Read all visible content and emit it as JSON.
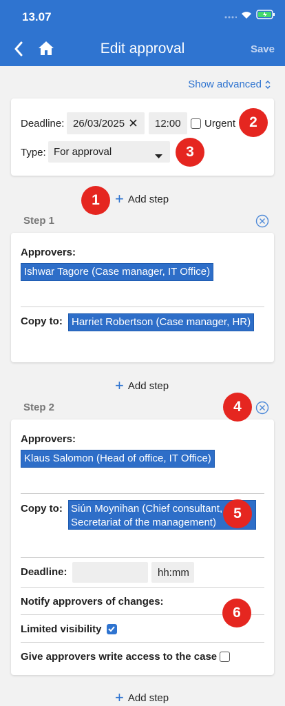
{
  "status": {
    "time": "13.07"
  },
  "header": {
    "title": "Edit approval",
    "save_label": "Save"
  },
  "show_advanced": "Show advanced",
  "settings": {
    "deadline_label": "Deadline:",
    "deadline_date": "26/03/2025",
    "deadline_time": "12:00",
    "urgent_label": "Urgent",
    "type_label": "Type:",
    "type_value": "For approval"
  },
  "add_step_label": "Add step",
  "steps": [
    {
      "title": "Step 1",
      "approvers_label": "Approvers:",
      "approvers": [
        "Ishwar Tagore (Case manager, IT Office)"
      ],
      "copy_label": "Copy to:",
      "copy_to": [
        "Harriet Robertson (Case manager, HR)"
      ]
    },
    {
      "title": "Step 2",
      "approvers_label": "Approvers:",
      "approvers": [
        "Klaus Salomon (Head of office, IT Office)"
      ],
      "copy_label": "Copy to:",
      "copy_to_line1": "Siún Moynihan (Chief consultant,",
      "copy_to_line2": "Secretariat of the management)",
      "deadline_label": "Deadline:",
      "time_placeholder": "hh:mm",
      "notify_label": "Notify approvers of changes:",
      "limited_label": "Limited visibility",
      "limited_checked": true,
      "write_access_label": "Give approvers write access to the case",
      "write_access_checked": false
    }
  ],
  "badges": [
    "1",
    "2",
    "3",
    "4",
    "5",
    "6"
  ],
  "colors": {
    "header": "#2f74d0",
    "badge": "#e52620",
    "chip": "#2e6ec8"
  }
}
